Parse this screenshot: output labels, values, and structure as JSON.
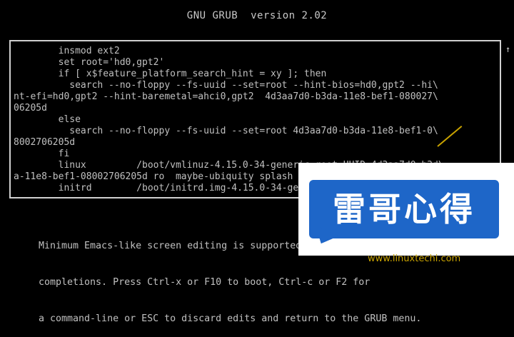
{
  "header": {
    "title": "GNU GRUB  version 2.02"
  },
  "editor": {
    "lines": [
      "        insmod ext2",
      "        set root='hd0,gpt2'",
      "        if [ x$feature_platform_search_hint = xy ]; then",
      "          search --no-floppy --fs-uuid --set=root --hint-bios=hd0,gpt2 --hi\\",
      "nt-efi=hd0,gpt2 --hint-baremetal=ahci0,gpt2  4d3aa7d0-b3da-11e8-bef1-080027\\",
      "06205d",
      "        else",
      "          search --no-floppy --fs-uuid --set=root 4d3aa7d0-b3da-11e8-bef1-0\\",
      "8002706205d",
      "        fi",
      "        linux         /boot/vmlinuz-4.15.0-34-generic root=UUID=4d3aa7d0-b3d\\",
      "a-11e8-bef1-08002706205d ro  maybe-ubiquity splash",
      "        initrd        /boot/initrd.img-4.15.0-34-generic"
    ],
    "scroll_up": "↑",
    "scroll_down": "↓"
  },
  "help": {
    "lines": [
      "Minimum Emacs-like screen editing is supported. TAB lists",
      "completions. Press Ctrl-x or F10 to boot, Ctrl-c or F2 for",
      "a command-line or ESC to discard edits and return to the GRUB menu."
    ]
  },
  "watermark": {
    "text": "雷哥心得",
    "url": "www.linuxtechi.com",
    "badge_color": "#1e66c8",
    "url_color": "#c8a200"
  }
}
